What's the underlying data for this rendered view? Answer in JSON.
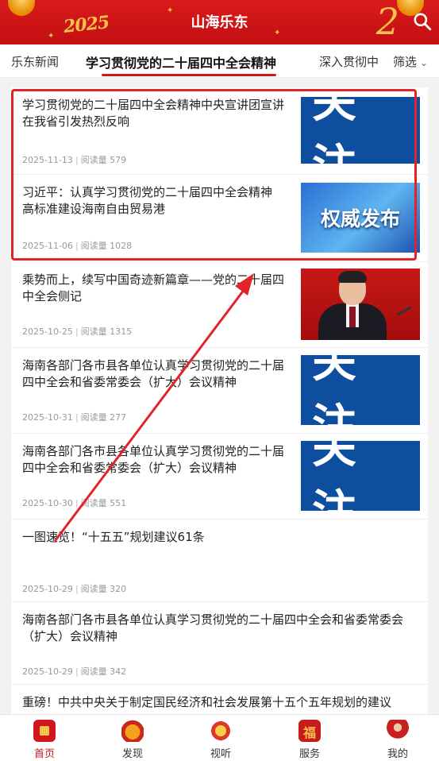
{
  "header": {
    "title": "山海乐东",
    "year_decoration": "2025",
    "snake_decoration": "2"
  },
  "tabs": {
    "left": "乐东新闻",
    "active": "学习贯彻党的二十届四中全会精神",
    "right": "深入贯彻中",
    "filter": "筛选"
  },
  "articles": [
    {
      "title": "学习贯彻党的二十届四中全会精神中央宣讲团宣讲在我省引发热烈反响",
      "date": "2025-11-13",
      "reads_label": "阅读量",
      "reads": "579",
      "thumb_text": "关注",
      "thumb": "guanzhu"
    },
    {
      "title": "习近平：认真学习贯彻党的二十届四中全会精神　高标准建设海南自由贸易港",
      "date": "2025-11-06",
      "reads_label": "阅读量",
      "reads": "1028",
      "thumb_text": "权威发布",
      "thumb": "quanwei"
    },
    {
      "title": "乘势而上，续写中国奇迹新篇章——党的二十届四中全会侧记",
      "date": "2025-10-25",
      "reads_label": "阅读量",
      "reads": "1315",
      "thumb": "photo"
    },
    {
      "title": "海南各部门各市县各单位认真学习贯彻党的二十届四中全会和省委常委会（扩大）会议精神",
      "date": "2025-10-31",
      "reads_label": "阅读量",
      "reads": "277",
      "thumb_text": "关注",
      "thumb": "guanzhu"
    },
    {
      "title": "海南各部门各市县各单位认真学习贯彻党的二十届四中全会和省委常委会（扩大）会议精神",
      "date": "2025-10-30",
      "reads_label": "阅读量",
      "reads": "551",
      "thumb_text": "关注",
      "thumb": "guanzhu"
    },
    {
      "title": "一图速览！“十五五”规划建议61条",
      "date": "2025-10-29",
      "reads_label": "阅读量",
      "reads": "320"
    },
    {
      "title": "海南各部门各市县各单位认真学习贯彻党的二十届四中全会和省委常委会（扩大）会议精神",
      "date": "2025-10-29",
      "reads_label": "阅读量",
      "reads": "342"
    },
    {
      "title": "重磅！中共中央关于制定国民经济和社会发展第十五个五年规划的建议"
    }
  ],
  "bottom_nav": [
    {
      "label": "首页",
      "icon": "home-icon"
    },
    {
      "label": "发现",
      "icon": "drum-icon"
    },
    {
      "label": "视听",
      "icon": "lion-dance-icon"
    },
    {
      "label": "服务",
      "icon": "fu-icon"
    },
    {
      "label": "我的",
      "icon": "profile-icon"
    }
  ],
  "colors": {
    "brand_red": "#d0161b",
    "annotation_red": "#e0242a",
    "tile_blue": "#0d4f9e"
  }
}
